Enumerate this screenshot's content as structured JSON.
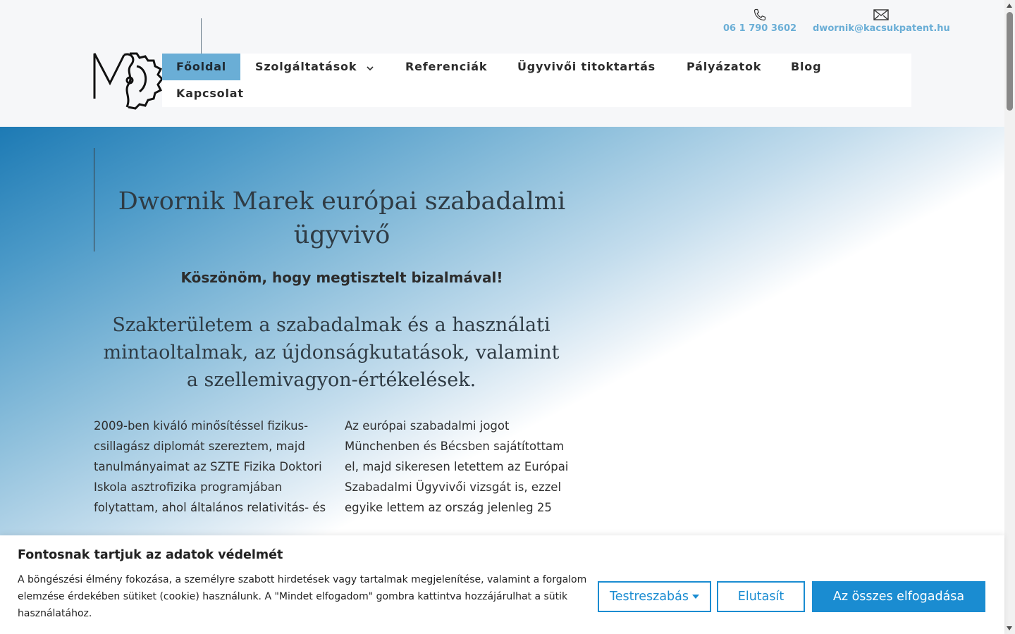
{
  "contact": {
    "phone": "06 1 790 3602",
    "email": "dwornik@kacsukpatent.hu",
    "phone_icon": "phone-icon",
    "email_icon": "envelope-icon"
  },
  "logo": {
    "name": "logo"
  },
  "nav": {
    "items": [
      {
        "label": "Főoldal",
        "active": true
      },
      {
        "label": "Szolgáltatások",
        "has_dropdown": true
      },
      {
        "label": "Referenciák"
      },
      {
        "label": "Ügyvivői titoktartás"
      },
      {
        "label": "Pályázatok"
      },
      {
        "label": "Blog"
      },
      {
        "label": "Kapcsolat"
      }
    ]
  },
  "hero": {
    "title": "Dwornik Marek európai szabadalmi ügyvivő",
    "thanks": "Köszönöm, hogy megtisztelt bizalmával!",
    "subtitle": "Szakterületem a szabadalmak és a használati mintaoltalmak, az újdonságkutatások, valamint a szellemivagyon-értékelések.",
    "col1": "2009-ben kiváló minősítéssel fizikus-csillagász diplomát szereztem, majd tanulmányaimat az SZTE Fizika Doktori Iskola asztrofizika programjában folytattam, ahol általános relativitás- és",
    "col2": "Az európai szabadalmi jogot Münchenben és Bécsben sajátítottam el, majd sikeresen letettem az Európai Szabadalmi Ügyvivői vizsgát is, ezzel egyike lettem az ország jelenleg 25"
  },
  "cookie": {
    "title": "Fontosnak tartjuk az adatok védelmét",
    "text": "A böngészési élmény fokozása, a személyre szabott hirdetések vagy tartalmak megjelenítése, valamint a forgalom elemzése érdekében sütiket (cookie) használunk. A \"Mindet elfogadom\" gombra kattintva hozzájárulhat a sütik használatához.",
    "customize": "Testreszabás",
    "reject": "Elutasít",
    "accept": "Az összes elfogadása"
  },
  "colors": {
    "accent": "#6aaed6",
    "button": "#1a8cd1"
  }
}
